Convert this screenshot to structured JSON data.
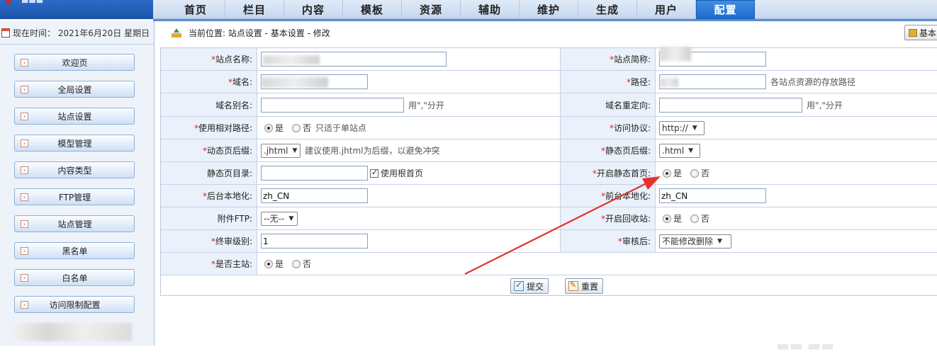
{
  "nav": {
    "tabs": [
      {
        "label": "首页"
      },
      {
        "label": "栏目"
      },
      {
        "label": "内容"
      },
      {
        "label": "模板"
      },
      {
        "label": "资源"
      },
      {
        "label": "辅助"
      },
      {
        "label": "维护"
      },
      {
        "label": "生成"
      },
      {
        "label": "用户"
      },
      {
        "label": "配置"
      }
    ],
    "active": "配置"
  },
  "sidebar": {
    "date_label": "现在时间： 2021年6月20日 星期日",
    "items": [
      {
        "label": "欢迎页"
      },
      {
        "label": "全局设置"
      },
      {
        "label": "站点设置"
      },
      {
        "label": "模型管理"
      },
      {
        "label": "内容类型"
      },
      {
        "label": "FTP管理"
      },
      {
        "label": "站点管理"
      },
      {
        "label": "黑名单"
      },
      {
        "label": "白名单"
      },
      {
        "label": "访问限制配置"
      }
    ]
  },
  "location": {
    "text": "当前位置: 站点设置 - 基本设置 - 修改",
    "basic_button": "基本"
  },
  "form": {
    "site_name_label": "站点名称:",
    "site_short_label": "站点简称:",
    "domain_label": "域名:",
    "path_label": "路径:",
    "path_hint": "各站点资源的存放路径",
    "alias_label": "域名别名:",
    "alias_hint": "用\",\"分开",
    "redirect_label": "域名重定向:",
    "redirect_hint": "用\",\"分开",
    "relative_label": "使用相对路径:",
    "relative_yes": "是",
    "relative_no": "否",
    "relative_hint": "只适于单站点",
    "protocol_label": "访问协议:",
    "protocol_value": "http://",
    "dyn_suffix_label": "动态页后缀:",
    "dyn_suffix_value": ".jhtml",
    "dyn_suffix_hint": "建议使用.jhtml为后缀，以避免冲突",
    "static_suffix_label": "静态页后缀:",
    "static_suffix_value": ".html",
    "static_dir_label": "静态页目录:",
    "static_dir_value": "",
    "use_root_index": "使用根首页",
    "static_index_label": "开启静态首页:",
    "static_index_yes": "是",
    "static_index_no": "否",
    "backend_locale_label": "后台本地化:",
    "backend_locale_value": "zh_CN",
    "frontend_locale_label": "前台本地化:",
    "frontend_locale_value": "zh_CN",
    "attach_ftp_label": "附件FTP:",
    "attach_ftp_value": "--无--",
    "recycle_label": "开启回收站:",
    "recycle_yes": "是",
    "recycle_no": "否",
    "final_level_label": "终审级别:",
    "final_level_value": "1",
    "after_review_label": "审核后:",
    "after_review_value": "不能修改删除",
    "is_master_label": "是否主站:",
    "is_master_yes": "是",
    "is_master_no": "否",
    "submit_label": "提交",
    "reset_label": "重置"
  },
  "colors": {
    "active_tab": "#1e6cc9",
    "label_bg": "#eaf1fa",
    "required": "#e02020",
    "annotation_arrow": "#e8322d"
  }
}
